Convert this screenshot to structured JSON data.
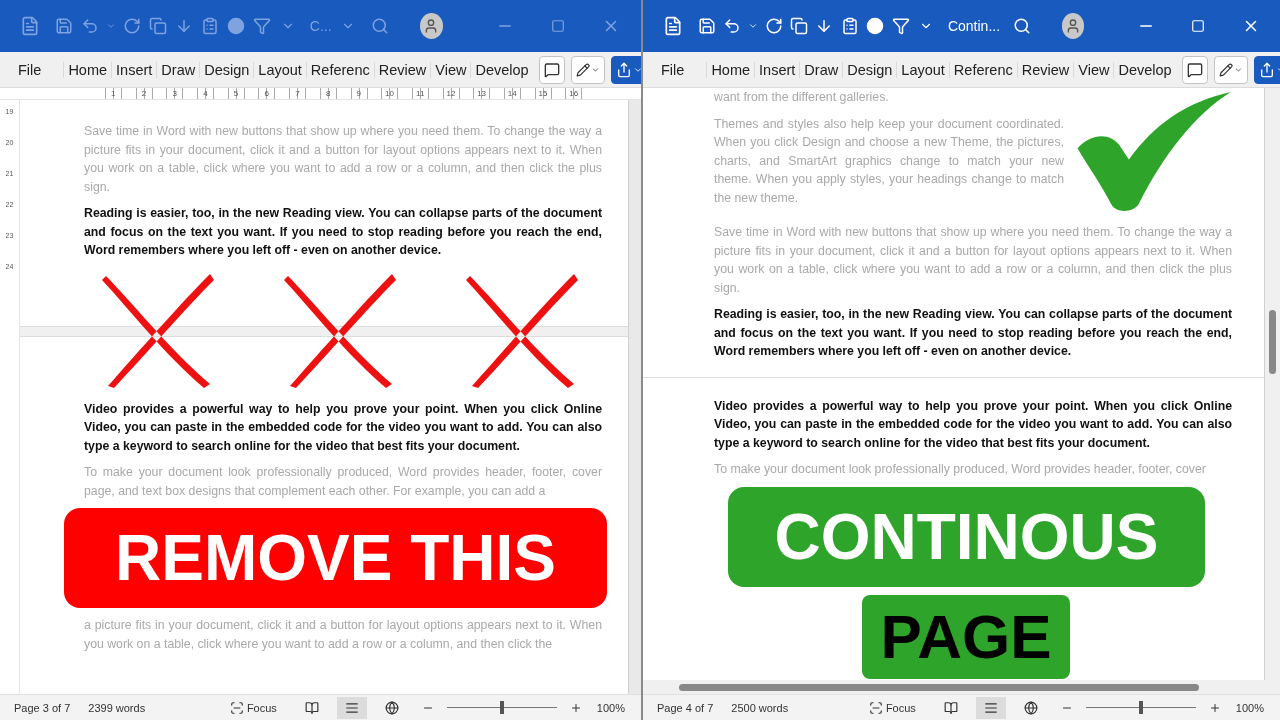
{
  "windows": [
    {
      "active": false,
      "title": "C...",
      "tabs": [
        "File",
        "Home",
        "Insert",
        "Draw",
        "Design",
        "Layout",
        "Referenc",
        "Review",
        "View",
        "Develop"
      ],
      "ruler": {
        "numbers": [
          "1",
          "2",
          "3",
          "4",
          "5",
          "6",
          "7",
          "8",
          "9",
          "10",
          "11",
          "12",
          "13",
          "14",
          "15",
          "16"
        ],
        "vertical_numbers": [
          "19",
          "20",
          "21",
          "22",
          "23",
          "24"
        ]
      },
      "document": [
        {
          "kind": "text",
          "bold": false,
          "text": "Save time in Word with new buttons that show up where you need them. To change the way a picture fits in your document, click it and a button for layout options appears next to it. When you work on a table, click where you want to add a row or a column, and then click the plus sign."
        },
        {
          "kind": "text",
          "bold": true,
          "text": "Reading is easier, too, in the new Reading view. You can collapse parts of the document and focus on the text you want. If you need to stop reading before you reach the end, Word remembers where you left off - even on another device."
        },
        {
          "kind": "cross_marks"
        },
        {
          "kind": "text",
          "bold": true,
          "text": "Video provides a powerful way to help you prove your point. When you click Online Video, you can paste in the embedded code for the video you want to add. You can also type a keyword to search online for the video that best fits your document."
        },
        {
          "kind": "text",
          "bold": false,
          "text": "To make your document look professionally produced, Word provides header, footer, cover page, and text box designs that complement each other. For example, you can add a"
        },
        {
          "kind": "banner",
          "text": "REMOVE THIS",
          "color": "#ff0000",
          "dark_text": false
        },
        {
          "kind": "text",
          "bold": false,
          "text": "a picture fits in your document, click it and a button for layout options appears next to it. When you work on a table, click where you want to add a row or a column, and then click the"
        }
      ],
      "status": {
        "page": "Page 3 of 7",
        "words": "2399 words",
        "focus": "Focus",
        "views": [
          {
            "selected": false
          },
          {
            "selected": true
          },
          {
            "selected": false
          }
        ],
        "zoom_slider": {
          "level": 0.5
        },
        "zoom": "100%"
      }
    },
    {
      "active": true,
      "title": "Contin...",
      "tabs": [
        "File",
        "Home",
        "Insert",
        "Draw",
        "Design",
        "Layout",
        "Referenc",
        "Review",
        "View",
        "Develop"
      ],
      "document": [
        {
          "kind": "check_row",
          "paragraphs": [
            {
              "bold": false,
              "text": "want from the different galleries."
            },
            {
              "bold": false,
              "text": "Themes and styles also help keep your document coordinated. When you click Design and choose a new Theme, the pictures, charts, and SmartArt graphics change to match your new theme. When you apply styles, your headings change to match the new theme."
            }
          ]
        },
        {
          "kind": "text",
          "bold": false,
          "text": "Save time in Word with new buttons that show up where you need them. To change the way a picture fits in your document, click it and a button for layout options appears next to it. When you work on a table, click where you want to add a row or a column, and then click the plus sign."
        },
        {
          "kind": "text",
          "bold": true,
          "text": "Reading is easier, too, in the new Reading view. You can collapse parts of the document and focus on the text you want. If you need to stop reading before you reach the end, Word remembers where you left off - even on another device."
        },
        {
          "kind": "page_break"
        },
        {
          "kind": "text",
          "bold": true,
          "text": "Video provides a powerful way to help you prove your point. When you click Online Video, you can paste in the embedded code for the video you want to add. You can also type a keyword to search online for the video that best fits your document."
        },
        {
          "kind": "text",
          "bold": false,
          "text": "To make your document look professionally produced, Word provides header, footer, cover"
        },
        {
          "kind": "banner",
          "text": "CONTINOUS",
          "color": "#2ea42a",
          "dark_text": false
        },
        {
          "kind": "small_banner",
          "text": "PAGE",
          "color": "#2ea42a",
          "dark_text": true
        }
      ],
      "status": {
        "page": "Page 4 of 7",
        "words": "2500 words",
        "focus": "Focus",
        "views": [
          {
            "selected": false
          },
          {
            "selected": true
          },
          {
            "selected": false
          }
        ],
        "zoom_slider": {
          "level": 0.5
        },
        "zoom": "100%"
      }
    }
  ]
}
